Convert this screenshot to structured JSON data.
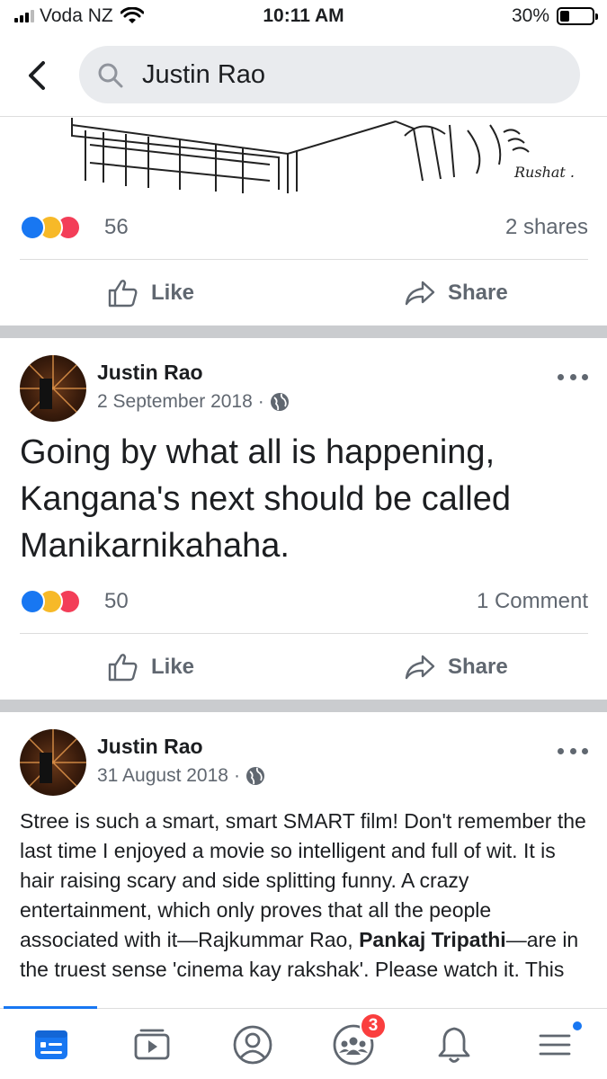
{
  "status_bar": {
    "carrier": "Voda NZ",
    "time": "10:11 AM",
    "battery_percent_label": "30%",
    "battery_level": 0.3
  },
  "search": {
    "query": "Justin Rao"
  },
  "posts": [
    {
      "reaction_count": "56",
      "right_stat": "2 shares",
      "like_label": "Like",
      "share_label": "Share"
    },
    {
      "author": "Justin Rao",
      "date": "2 September 2018",
      "separator": "·",
      "text": "Going by what all is happening, Kangana's next should be called Manikarnikahaha.",
      "reaction_count": "50",
      "right_stat": "1 Comment",
      "like_label": "Like",
      "share_label": "Share"
    },
    {
      "author": "Justin Rao",
      "date": "31 August 2018",
      "separator": "·",
      "text_before_bold": "Stree is such a smart, smart SMART film! Don't remember the last time I enjoyed a movie so intelligent and full of wit. It is hair raising scary and side splitting funny. A crazy entertainment, which only proves that all the people associated with it—Rajkummar Rao, ",
      "text_bold": "Pankaj Tripathi",
      "text_after_bold": "—are in the truest sense 'cinema kay rakshak'. Please watch it. This"
    }
  ],
  "tab_bar": {
    "tabs": [
      "news-feed",
      "watch",
      "profile",
      "groups",
      "notifications",
      "menu"
    ],
    "groups_badge": "3"
  },
  "colors": {
    "brand_blue": "#1877f2",
    "badge_red": "#fa3e3e",
    "divider_gray": "#cacccf"
  }
}
